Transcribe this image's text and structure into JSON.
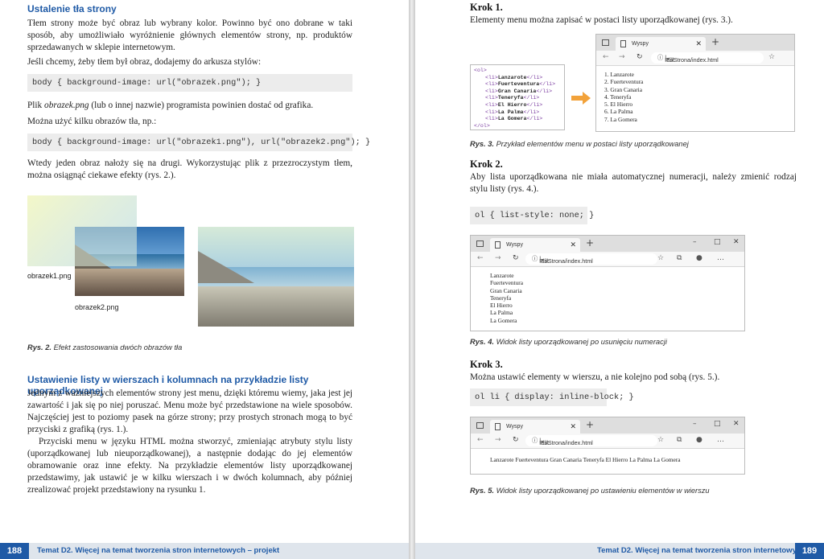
{
  "left": {
    "section1_title": "Ustalenie tła strony",
    "p1": "Tłem strony może być obraz lub wybrany kolor. Powinno być ono dobrane w taki sposób, aby umożliwiało wyróżnienie głównych elementów strony, np. produktów sprzedawanych w sklepie internetowym.",
    "p2": "Jeśli chcemy, żeby tłem był obraz, dodajemy do arkusza stylów:",
    "code1": "body { background-image: url(\"obrazek.png\"); }",
    "p3_em": "obrazek.png",
    "p3_pre": "Plik ",
    "p3_post": " (lub o innej nazwie) programista powinien dostać od grafika.",
    "p4": "Można użyć kilku obrazów tła, np.:",
    "code2": "body { background-image: url(\"obrazek1.png\"), url(\"obrazek2.png\"); }",
    "p5": "Wtedy jeden obraz nałoży się na drugi. Wykorzystując plik z przezroczystym tłem, można osiągnąć ciekawe efekty (rys. 2.).",
    "img1_label": "obrazek1.png",
    "img2_label": "obrazek2.png",
    "fig2_num": "Rys. 2.",
    "fig2_text": "Efekt zastosowania dwóch obrazów tła",
    "section2_title": "Ustawienie listy w wierszach i kolumnach na przykładzie listy uporządkowanej",
    "p6": "Jednym z ważniejszych elementów strony jest menu, dzięki któremu wiemy, jaka jest jej zawartość i jak się po niej poruszać. Menu może być przedstawione na wiele sposobów. Najczęściej jest to poziomy pasek na górze strony; przy prostych stronach mogą to być przyciski z grafiką (rys. 1.).",
    "p7": "Przyciski menu w języku HTML można stworzyć, zmieniając atrybuty stylu listy (uporządkowanej lub nieuporządkowanej), a następnie dodając do jej elementów obramowanie oraz inne efekty. Na przykładzie elementów listy uporządkowanej przedstawimy, jak ustawić je w kilku wierszach i w dwóch kolumnach, aby później zrealizować projekt przedstawiony na rysunku 1.",
    "page_num": "188",
    "footer": "Temat D2. Więcej na temat tworzenia stron internetowych – projekt"
  },
  "right": {
    "step1_title": "Krok 1.",
    "step1_text": "Elementy menu można zapisać w postaci listy uporządkowanej (rys. 3.).",
    "code_open": "<ol>",
    "code_close": "</ol>",
    "li_open": "<li>",
    "li_close": "</li>",
    "items": [
      "Lanzarote",
      "Fuerteventura",
      "Gran Canaria",
      "Teneryfa",
      "El Hierro",
      "La Palma",
      "La Gomera"
    ],
    "numbered_items": [
      "1. Lanzarote",
      "2. Fuerteventura",
      "3. Gran Canaria",
      "4. Teneryfa",
      "5. El Hierro",
      "6. La Palma",
      "7. La Gomera"
    ],
    "tab_title": "Wyspy",
    "url_prefix": "Plik",
    "url_path": "E:/Strona/index.html",
    "fig3_num": "Rys. 3.",
    "fig3_text": "Przykład elementów menu w postaci listy uporządkowanej",
    "step2_title": "Krok 2.",
    "step2_text": "Aby lista uporządkowana nie miała automatycznej numeracji, należy zmienić rodzaj stylu listy (rys. 4.).",
    "code3": "ol { list-style: none; }",
    "fig4_num": "Rys. 4.",
    "fig4_text": "Widok listy uporządkowanej po usunięciu numeracji",
    "step3_title": "Krok 3.",
    "step3_text": "Można ustawić elementy w wierszu, a nie kolejno pod sobą (rys. 5.).",
    "code4": "ol li { display: inline-block; }",
    "inline_list": "Lanzarote Fuerteventura Gran Canaria Teneryfa El Hierro La Palma La Gomera",
    "fig5_num": "Rys. 5.",
    "fig5_text": "Widok listy uporządkowanej po ustawieniu elementów w wierszu",
    "page_num": "189",
    "footer": "Temat D2. Więcej na temat tworzenia stron internetowych – projekt"
  },
  "colors": {
    "accent": "#1f5aa6",
    "footer_bg": "#dfe5ec",
    "code_bg": "#ececec"
  }
}
